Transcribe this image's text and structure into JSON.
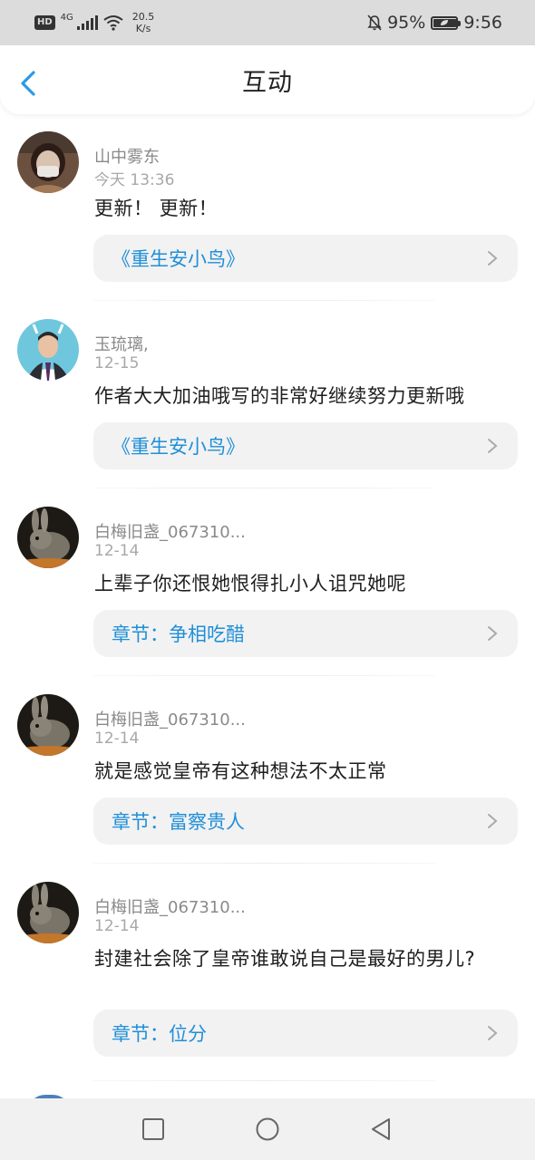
{
  "status_bar": {
    "hd": "HD",
    "network": "4G",
    "speed_value": "20.5",
    "speed_unit": "K/s",
    "battery_percent": "95%",
    "battery_level": 0.95,
    "time": "9:56"
  },
  "header": {
    "title": "互动"
  },
  "comments": [
    {
      "user": "山中雾东",
      "time": "今天 13:36",
      "text": "更新！ 更新！",
      "link": "《重生安小鸟》"
    },
    {
      "user": "玉琉璃,",
      "time": "12-15",
      "text": "作者大大加油哦写的非常好继续努力更新哦",
      "link": "《重生安小鸟》"
    },
    {
      "user": "白梅旧盏_067310...",
      "time": "12-14",
      "text": "上辈子你还恨她恨得扎小人诅咒她呢",
      "link": "章节：争相吃醋"
    },
    {
      "user": "白梅旧盏_067310...",
      "time": "12-14",
      "text": "就是感觉皇帝有这种想法不太正常",
      "link": "章节：富察贵人"
    },
    {
      "user": "白梅旧盏_067310...",
      "time": "12-14",
      "text": "封建社会除了皇帝谁敢说自己是最好的男儿?",
      "link": "章节：位分"
    }
  ],
  "colors": {
    "link": "#1f8fd8",
    "background": "#ffffff",
    "status_bar": "#dcdcdc"
  }
}
